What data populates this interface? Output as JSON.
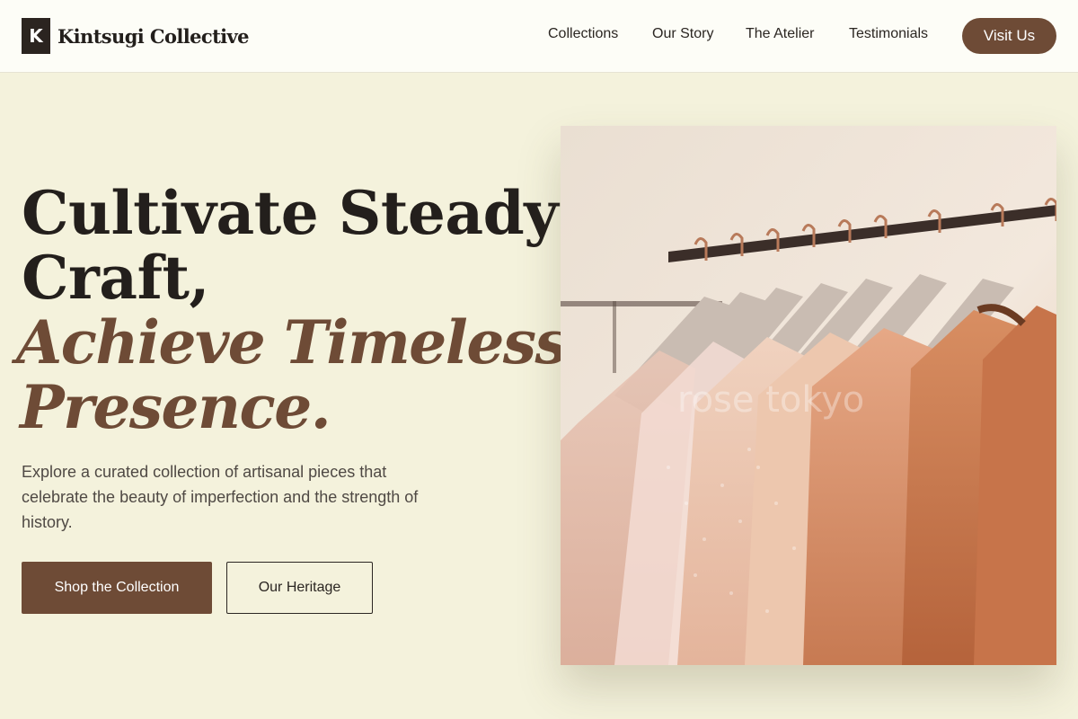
{
  "brand": {
    "logo_letter": "K",
    "name": "Kintsugi Collective"
  },
  "nav": {
    "items": [
      {
        "label": "Collections"
      },
      {
        "label": "Our Story"
      },
      {
        "label": "The Atelier"
      },
      {
        "label": "Testimonials"
      }
    ],
    "cta_label": "Visit Us"
  },
  "hero": {
    "headline_line1": "Cultivate Steady",
    "headline_line2": "Craft,",
    "headline_line3": "Achieve Timeless",
    "headline_line4": "Presence.",
    "subtext": "Explore a curated collection of artisanal pieces that celebrate the beauty of imperfection and the strength of history.",
    "primary_cta": "Shop the Collection",
    "secondary_cta": "Our Heritage",
    "image_watermark": "rose tokyo",
    "image_icon": "clothing-rack-photo"
  },
  "colors": {
    "accent": "#6e4b36",
    "background": "#f4f2dc",
    "header_bg": "#fdfdf7",
    "text_dark": "#231f1c"
  }
}
